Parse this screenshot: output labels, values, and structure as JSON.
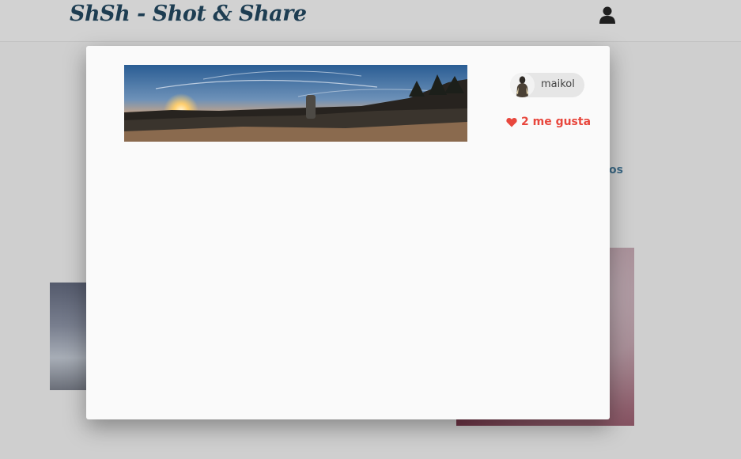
{
  "navbar": {
    "brand": "ShSh - Shot & Share",
    "user_icon": "user-icon"
  },
  "background": {
    "partial_link": "os"
  },
  "modal": {
    "photo_icon": "panorama-sunset-photo",
    "author": {
      "name": "maikol",
      "avatar_icon": "avatar-silhouette"
    },
    "likes": {
      "icon": "heart-icon",
      "label": "2 me gusta",
      "color": "#e8473d"
    }
  },
  "colors": {
    "brand": "#1d3d52",
    "accent": "#e8473d"
  }
}
